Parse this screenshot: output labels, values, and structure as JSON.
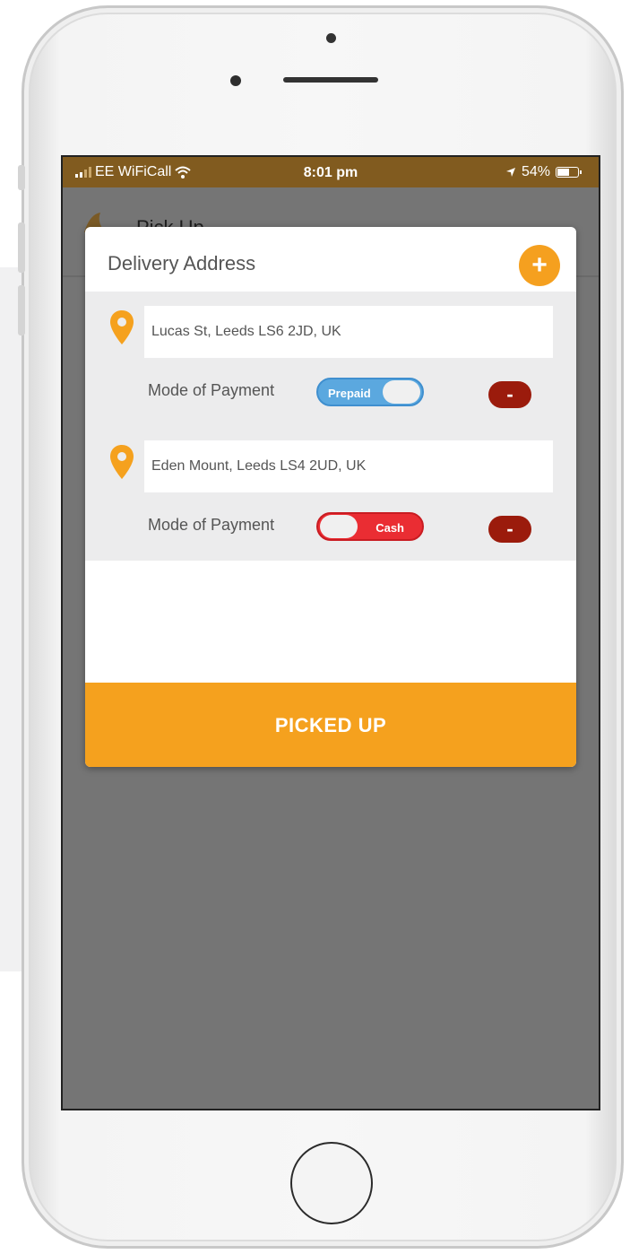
{
  "status_bar": {
    "carrier": "EE WiFiCall",
    "time": "8:01 pm",
    "battery": "54%"
  },
  "underlay": {
    "title": "Pick Up"
  },
  "modal": {
    "title": "Delivery Address",
    "add_label": "+",
    "addresses": [
      {
        "address": "Lucas St, Leeds LS6 2JD, UK",
        "payment_label": "Mode of Payment",
        "payment_mode": "Prepaid",
        "remove_label": "-"
      },
      {
        "address": "Eden Mount, Leeds LS4 2UD, UK",
        "payment_label": "Mode of Payment",
        "payment_mode": "Cash",
        "remove_label": "-"
      }
    ],
    "action_label": "PICKED UP"
  },
  "colors": {
    "accent": "#f5a11e",
    "status_bar": "#815b1f",
    "prepaid": "#5ba8df",
    "cash": "#ea2d33",
    "remove": "#9b1b0c"
  },
  "icons": [
    "wifi-icon",
    "location-arrow-icon",
    "battery-icon",
    "map-pin-icon",
    "plus-icon",
    "minus-icon"
  ]
}
